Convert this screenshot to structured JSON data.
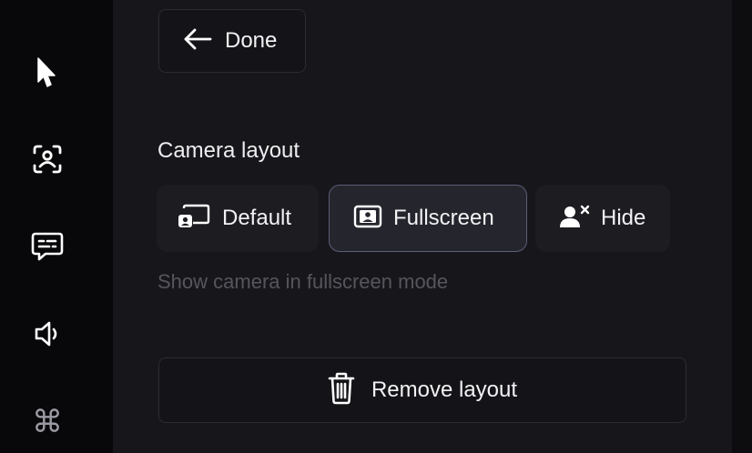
{
  "sidebar": {
    "items": [
      {
        "icon": "cursor-icon"
      },
      {
        "icon": "camera-frame-icon"
      },
      {
        "icon": "caption-bubble-icon"
      },
      {
        "icon": "speaker-icon"
      },
      {
        "icon": "command-icon",
        "glyph": "⌘"
      }
    ]
  },
  "done_button": {
    "label": "Done",
    "icon": "arrow-left-icon"
  },
  "camera_layout": {
    "title": "Camera layout",
    "options": [
      {
        "label": "Default",
        "icon": "default-layout-icon"
      },
      {
        "label": "Fullscreen",
        "icon": "fullscreen-person-icon",
        "selected": true
      },
      {
        "label": "Hide",
        "icon": "hide-person-icon"
      }
    ],
    "hint": "Show camera in fullscreen mode"
  },
  "remove_button": {
    "label": "Remove layout",
    "icon": "trash-icon"
  },
  "colors": {
    "rail_bg": "#08080a",
    "panel_bg": "#17171b",
    "selected_border": "#5b5c78",
    "hint_text": "#55555d"
  }
}
